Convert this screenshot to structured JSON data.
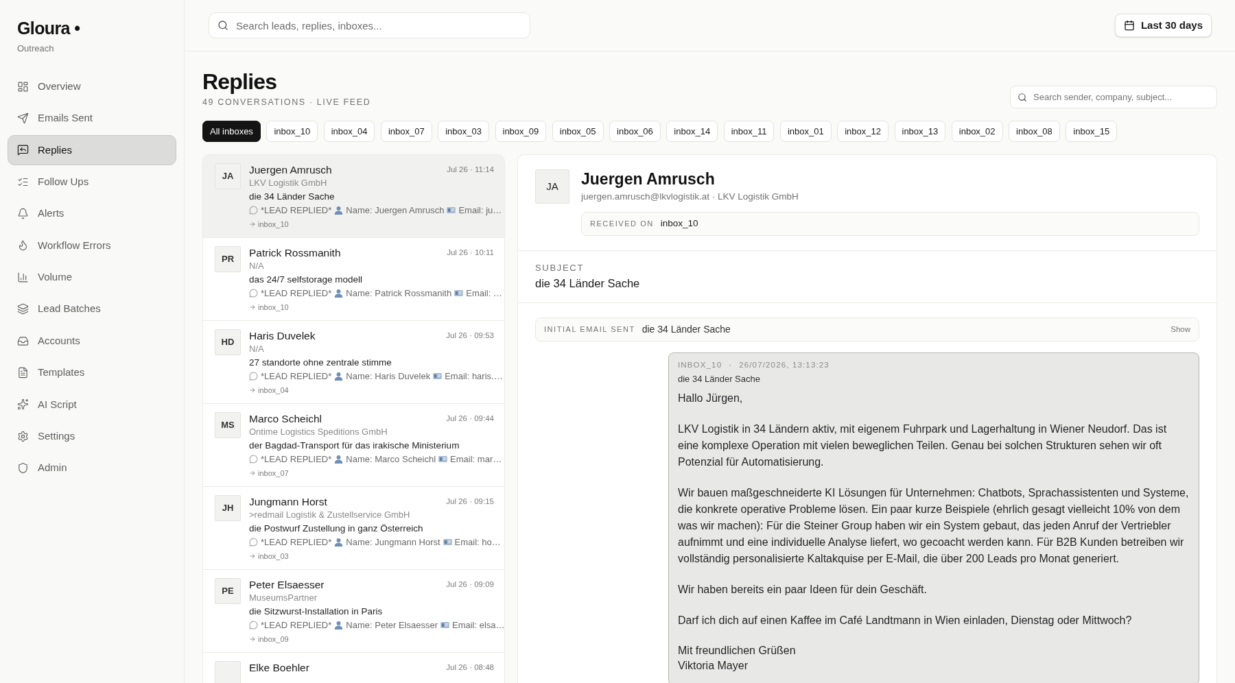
{
  "sidebar": {
    "logo": "Gloura •",
    "subtitle": "Outreach",
    "items": [
      {
        "label": "Overview",
        "selected": false
      },
      {
        "label": "Emails Sent",
        "selected": false
      },
      {
        "label": "Replies",
        "selected": true
      },
      {
        "label": "Follow Ups",
        "selected": false
      },
      {
        "label": "Alerts",
        "selected": false
      },
      {
        "label": "Workflow Errors",
        "selected": false
      },
      {
        "label": "Volume",
        "selected": false
      },
      {
        "label": "Lead Batches",
        "selected": false
      },
      {
        "label": "Accounts",
        "selected": false
      },
      {
        "label": "Templates",
        "selected": false
      },
      {
        "label": "AI Script",
        "selected": false
      },
      {
        "label": "Settings",
        "selected": false
      },
      {
        "label": "Admin",
        "selected": false
      }
    ]
  },
  "topbar": {
    "search": {
      "placeholder": "Search leads, replies, inboxes..."
    },
    "date_range": "Last 30 days"
  },
  "header": {
    "title": "Replies",
    "subtitle": "49 CONVERSATIONS · LIVE FEED",
    "search": {
      "placeholder": "Search sender, company, subject..."
    }
  },
  "filters": [
    {
      "label": "All inboxes",
      "selected": true
    },
    {
      "label": "inbox_10",
      "selected": false
    },
    {
      "label": "inbox_04",
      "selected": false
    },
    {
      "label": "inbox_07",
      "selected": false
    },
    {
      "label": "inbox_03",
      "selected": false
    },
    {
      "label": "inbox_09",
      "selected": false
    },
    {
      "label": "inbox_05",
      "selected": false
    },
    {
      "label": "inbox_06",
      "selected": false
    },
    {
      "label": "inbox_14",
      "selected": false
    },
    {
      "label": "inbox_11",
      "selected": false
    },
    {
      "label": "inbox_01",
      "selected": false
    },
    {
      "label": "inbox_12",
      "selected": false
    },
    {
      "label": "inbox_13",
      "selected": false
    },
    {
      "label": "inbox_02",
      "selected": false
    },
    {
      "label": "inbox_08",
      "selected": false
    },
    {
      "label": "inbox_15",
      "selected": false
    }
  ],
  "conversations": [
    {
      "initials": "JA",
      "name": "Juergen Amrusch",
      "time": "Jul 26 · 11:14",
      "company": "LKV Logistik GmbH",
      "subject": "die 34 Länder Sache",
      "preview": {
        "tag": "*LEAD REPLIED*",
        "name": "Name: Juergen Amrusch",
        "email": "Email: ju…"
      },
      "inbox": "inbox_10",
      "selected": true
    },
    {
      "initials": "PR",
      "name": "Patrick Rossmanith",
      "time": "Jul 26 · 10:11",
      "company": "N/A",
      "subject": "das 24/7 selfstorage modell",
      "preview": {
        "tag": "*LEAD REPLIED*",
        "name": "Name: Patrick Rossmanith",
        "email": "Email: …"
      },
      "inbox": "inbox_10",
      "selected": false
    },
    {
      "initials": "HD",
      "name": "Haris Duvelek",
      "time": "Jul 26 · 09:53",
      "company": "N/A",
      "subject": "27 standorte ohne zentrale stimme",
      "preview": {
        "tag": "*LEAD REPLIED*",
        "name": "Name: Haris Duvelek",
        "email": "Email: haris.…"
      },
      "inbox": "inbox_04",
      "selected": false
    },
    {
      "initials": "MS",
      "name": "Marco Scheichl",
      "time": "Jul 26 · 09:44",
      "company": "Ontime Logistics Speditions GmbH",
      "subject": "der Bagdad-Transport für das irakische Ministerium",
      "preview": {
        "tag": "*LEAD REPLIED*",
        "name": "Name: Marco Scheichl",
        "email": "Email: mar…"
      },
      "inbox": "inbox_07",
      "selected": false
    },
    {
      "initials": "JH",
      "name": "Jungmann Horst",
      "time": "Jul 26 · 09:15",
      "company": ">redmail Logistik & Zustellservice GmbH",
      "subject": "die Postwurf Zustellung in ganz Österreich",
      "preview": {
        "tag": "*LEAD REPLIED*",
        "name": "Name: Jungmann Horst",
        "email": "Email: ho…"
      },
      "inbox": "inbox_03",
      "selected": false
    },
    {
      "initials": "PE",
      "name": "Peter Elsaesser",
      "time": "Jul 26 · 09:09",
      "company": "MuseumsPartner",
      "subject": "die Sitzwurst-Installation in Paris",
      "preview": {
        "tag": "*LEAD REPLIED*",
        "name": "Name: Peter Elsaesser",
        "email": "Email: elsa…"
      },
      "inbox": "inbox_09",
      "selected": false
    },
    {
      "name": "Elke Boehler",
      "time": "Jul 26 · 08:48",
      "selected": false
    }
  ],
  "detail": {
    "initials": "JA",
    "name": "Juergen Amrusch",
    "contact": "juergen.amrusch@lkvlogistik.at · LKV Logistik GmbH",
    "received_on": {
      "label": "RECEIVED ON",
      "value": "inbox_10"
    },
    "subject": {
      "label": "SUBJECT",
      "value": "die 34 Länder Sache"
    },
    "initial_email": {
      "label": "INITIAL EMAIL SENT",
      "value": "die 34 Länder Sache",
      "action": "Show"
    },
    "message": {
      "inbox": "INBOX_10",
      "separator": "·",
      "timestamp": "26/07/2026, 13:13:23",
      "subject": "die 34 Länder Sache",
      "paragraphs": [
        "Hallo Jürgen,",
        "LKV Logistik in 34 Ländern aktiv, mit eigenem Fuhrpark und Lagerhaltung in Wiener Neudorf. Das ist eine komplexe Operation mit vielen beweglichen Teilen. Genau bei solchen Strukturen sehen wir oft Potenzial für Automatisierung.",
        "Wir bauen maßgeschneiderte KI Lösungen für Unternehmen: Chatbots, Sprachassistenten und Systeme, die konkrete operative Probleme lösen. Ein paar kurze Beispiele (ehrlich gesagt vielleicht 10% von dem was wir machen): Für die Steiner Group haben wir ein System gebaut, das jeden Anruf der Vertriebler aufnimmt und eine individuelle Analyse liefert, wo gecoacht werden kann. Für B2B Kunden betreiben wir vollständig personalisierte Kaltakquise per E-Mail, die über 200 Leads pro Monat generiert.",
        "Wir haben bereits ein paar Ideen für dein Geschäft.",
        "Darf ich dich auf einen Kaffee im Café Landtmann in Wien einladen, Dienstag oder Mittwoch?"
      ],
      "signature": [
        "Mit freundlichen Grüßen",
        "Viktoria Mayer"
      ]
    }
  }
}
